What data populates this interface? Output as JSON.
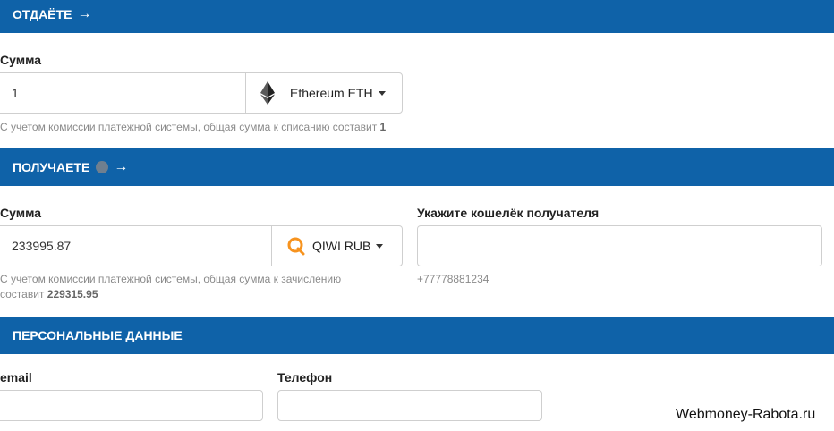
{
  "give": {
    "header": "ОТДАЁТЕ",
    "arrow": "→",
    "amount_label": "Сумма",
    "amount_value": "1",
    "currency": "Ethereum ETH",
    "currency_icon": "ethereum-icon",
    "note_text": "С учетом комиссии платежной системы, общая сумма к списанию составит",
    "note_value": "1"
  },
  "receive": {
    "header": "ПОЛУЧАЕТЕ",
    "arrow": "→",
    "amount_label": "Сумма",
    "amount_value": "233995.87",
    "currency": "QIWI RUB",
    "currency_icon": "qiwi-icon",
    "note_text": "С учетом комиссии платежной системы, общая сумма к зачислению составит",
    "note_value": "229315.95",
    "wallet_label": "Укажите кошелёк получателя",
    "wallet_value": "",
    "wallet_hint": "+77778881234"
  },
  "personal": {
    "header": "ПЕРСОНАЛЬНЫЕ ДАННЫЕ",
    "email_label": "email",
    "email_value": "",
    "phone_label": "Телефон",
    "phone_value": ""
  },
  "watermark": "Webmoney-Rabota.ru",
  "colors": {
    "header_bg": "#0f62a8",
    "qiwi_orange": "#f7931e"
  }
}
